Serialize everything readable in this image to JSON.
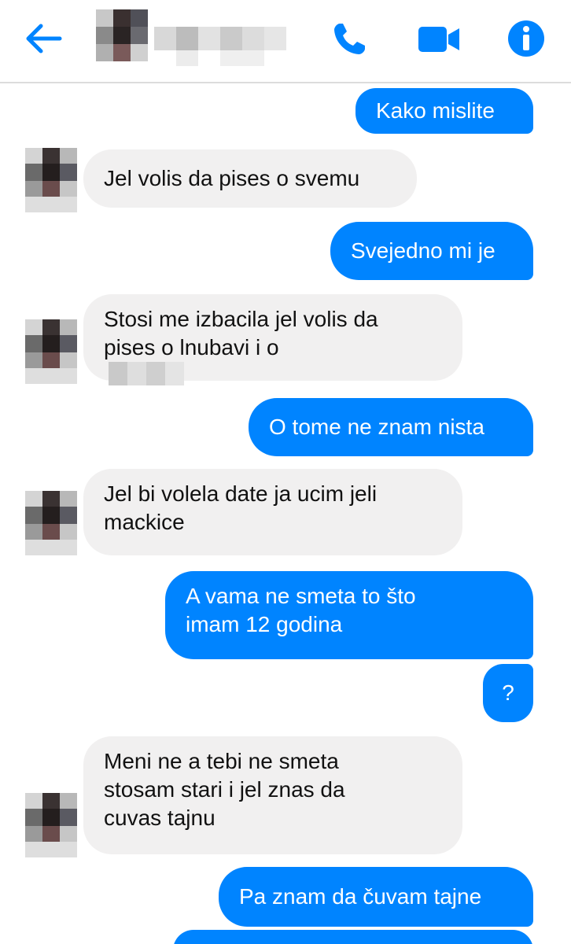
{
  "header": {
    "back_icon": "arrow-left-icon",
    "call_icon": "phone-icon",
    "video_icon": "video-camera-icon",
    "info_icon": "info-icon",
    "accent_color": "#0084ff"
  },
  "messages": [
    {
      "id": "m1",
      "direction": "out",
      "lines": [
        "Kako mislite"
      ]
    },
    {
      "id": "m2",
      "direction": "in",
      "lines": [
        "Jel volis da pises o svemu"
      ]
    },
    {
      "id": "m3",
      "direction": "out",
      "lines": [
        "Svejedno mi je"
      ]
    },
    {
      "id": "m4",
      "direction": "in",
      "lines": [
        "Stosi me izbacila jel volis da",
        "pises o lnubavi i o"
      ]
    },
    {
      "id": "m5",
      "direction": "out",
      "lines": [
        "O tome ne znam nista"
      ]
    },
    {
      "id": "m6",
      "direction": "in",
      "lines": [
        "Jel bi volela date ja ucim jeli",
        "mackice"
      ]
    },
    {
      "id": "m7",
      "direction": "out",
      "lines": [
        "A vama ne smeta to što",
        "imam 12 godina"
      ]
    },
    {
      "id": "m8",
      "direction": "out",
      "lines": [
        "?"
      ]
    },
    {
      "id": "m9",
      "direction": "in",
      "lines": [
        "Meni ne a tebi ne smeta",
        "stosam stari i jel znas da",
        "cuvas tajnu"
      ]
    },
    {
      "id": "m10",
      "direction": "out",
      "lines": [
        "Pa znam da čuvam tajne"
      ]
    }
  ],
  "colors": {
    "outgoing_bubble": "#0084ff",
    "incoming_bubble": "#f1f0f0"
  }
}
